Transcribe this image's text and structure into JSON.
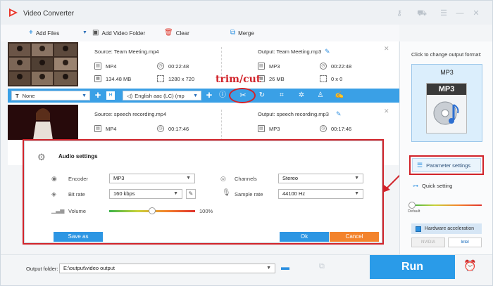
{
  "app": {
    "title": "Video Converter"
  },
  "toolbar": {
    "add_files": "Add Files",
    "add_video_folder": "Add Video Folder",
    "clear": "Clear",
    "merge": "Merge"
  },
  "files": [
    {
      "source": "Source: Team Meeting.mp4",
      "src_format": "MP4",
      "src_duration": "00:22:48",
      "src_size": "134.48 MB",
      "src_resolution": "1280 x 720",
      "output": "Output: Team Meeting.mp3",
      "out_format": "MP3",
      "out_duration": "00:22:48",
      "out_size": "26 MB",
      "out_resolution": "0 x 0"
    },
    {
      "source": "Source: speech recording.mp4",
      "src_format": "MP4",
      "src_duration": "00:17:46",
      "output": "Output: speech recording.mp3",
      "out_format": "MP3",
      "out_duration": "00:17:46"
    }
  ],
  "edit_bar": {
    "subtitle": "None",
    "audio_track": "English aac (LC) (mp"
  },
  "annotation": {
    "trim": "trim/cut"
  },
  "audio_settings": {
    "title": "Audio settings",
    "encoder_label": "Encoder",
    "encoder": "MP3",
    "channels_label": "Channels",
    "channels": "Stereo",
    "bitrate_label": "Bit rate",
    "bitrate": "160 kbps",
    "samplerate_label": "Sample rate",
    "samplerate": "44100 Hz",
    "volume_label": "Volume",
    "volume_value": "100%",
    "volume_level": 0.5,
    "save_as": "Save as",
    "ok": "Ok",
    "cancel": "Cancel"
  },
  "right_panel": {
    "hint": "Click to change output format:",
    "format": "MP3",
    "format_icon_text": "MP3",
    "parameter_settings": "Parameter settings",
    "quick_setting": "Quick setting",
    "quality_default": "Default",
    "hardware_acceleration": "Hardware acceleration",
    "nvidia": "NVIDIA",
    "intel": "Intel"
  },
  "bottom": {
    "output_folder_label": "Output folder:",
    "output_folder": "E:\\output\\video output",
    "run": "Run"
  },
  "colors": {
    "accent": "#2a9be8",
    "highlight": "#d1232a",
    "orange": "#f3832c"
  }
}
